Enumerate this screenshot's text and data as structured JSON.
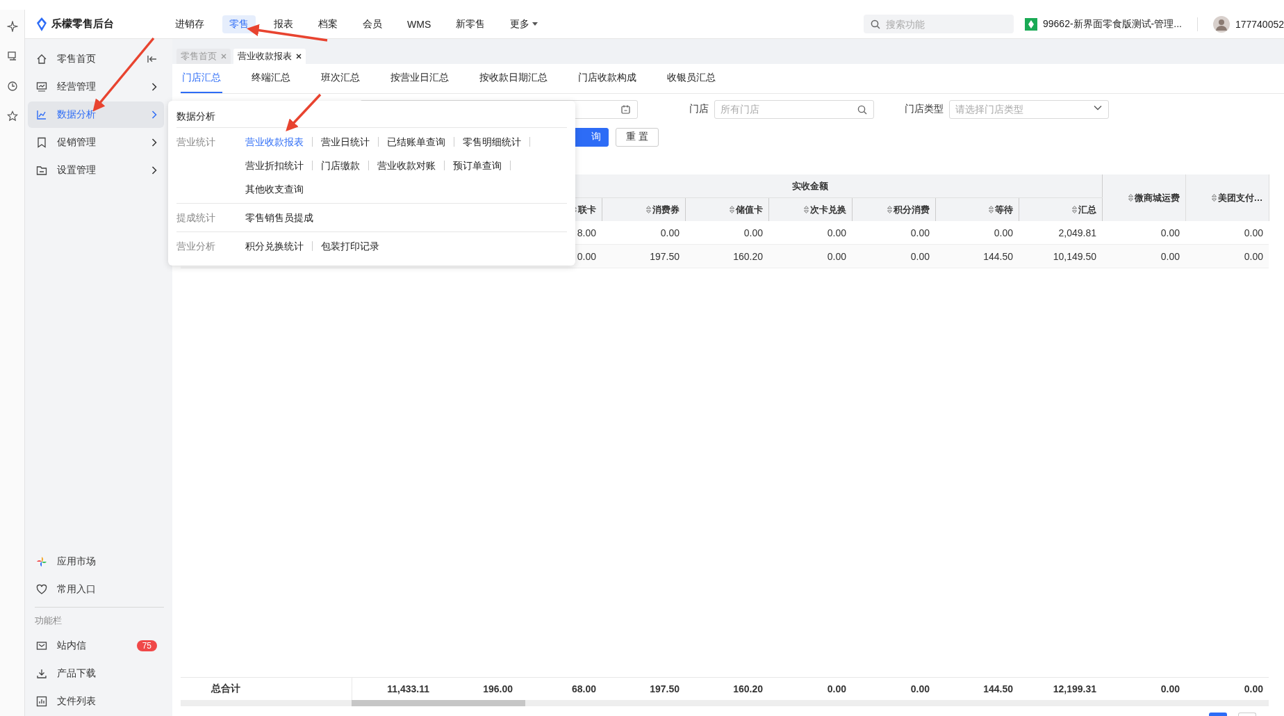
{
  "header": {
    "logo": "乐檬零售后台",
    "nav": [
      {
        "label": "进销存",
        "selected": false,
        "kind": "link"
      },
      {
        "label": "零售",
        "selected": true,
        "kind": "link"
      },
      {
        "label": "报表",
        "selected": false,
        "kind": "link"
      },
      {
        "label": "档案",
        "selected": false,
        "kind": "link"
      },
      {
        "label": "会员",
        "selected": false,
        "kind": "link"
      },
      {
        "label": "WMS",
        "selected": false,
        "kind": "link"
      },
      {
        "label": "新零售",
        "selected": false,
        "kind": "link"
      },
      {
        "label": "更多",
        "selected": false,
        "kind": "dropdown"
      }
    ],
    "search": {
      "placeholder": "搜索功能"
    },
    "store": "99662-新界面零食版测试-管理...",
    "user": "177740052"
  },
  "sidebar": {
    "items": [
      {
        "label": "零售首页",
        "selected": false,
        "kind": "home"
      },
      {
        "label": "经营管理",
        "selected": false,
        "kind": "group"
      },
      {
        "label": "数据分析",
        "selected": true,
        "kind": "group"
      },
      {
        "label": "促销管理",
        "selected": false,
        "kind": "group"
      },
      {
        "label": "设置管理",
        "selected": false,
        "kind": "group"
      }
    ],
    "shortcuts": [
      "应用市场",
      "常用入口"
    ],
    "section_label": "功能栏",
    "tools": [
      {
        "label": "站内信",
        "badge": "75"
      },
      {
        "label": "产品下载"
      },
      {
        "label": "文件列表"
      }
    ]
  },
  "page_tabs": [
    {
      "label": "零售首页",
      "selected": false
    },
    {
      "label": "营业收款报表",
      "selected": true
    }
  ],
  "report_tabs": [
    {
      "label": "门店汇总",
      "selected": true
    },
    {
      "label": "终端汇总",
      "selected": false
    },
    {
      "label": "班次汇总",
      "selected": false
    },
    {
      "label": "按营业日汇总",
      "selected": false
    },
    {
      "label": "按收款日期汇总",
      "selected": false
    },
    {
      "label": "门店收款构成",
      "selected": false
    },
    {
      "label": "收银员汇总",
      "selected": false
    }
  ],
  "filters": {
    "store": {
      "label": "门店",
      "placeholder": "所有门店"
    },
    "store_type": {
      "label": "门店类型",
      "placeholder": "请选择门店类型"
    }
  },
  "buttons": [
    {
      "label": "询",
      "kind": "primary"
    },
    {
      "label": "重置",
      "kind": "default"
    }
  ],
  "menu": {
    "title": "数据分析",
    "groups": [
      {
        "label": "营业统计",
        "items": [
          {
            "label": "营业收款报表",
            "selected": true
          },
          {
            "label": "营业日统计",
            "selected": false
          },
          {
            "label": "已结账单查询",
            "selected": false
          },
          {
            "label": "零售明细统计",
            "selected": false
          },
          {
            "label": "营业折扣统计",
            "selected": false
          },
          {
            "label": "门店缴款",
            "selected": false
          },
          {
            "label": "营业收款对账",
            "selected": false
          },
          {
            "label": "预订单查询",
            "selected": false
          },
          {
            "label": "其他收支查询",
            "selected": false
          }
        ]
      },
      {
        "label": "提成统计",
        "items": [
          {
            "label": "零售销售员提成",
            "selected": false
          }
        ]
      },
      {
        "label": "营业分析",
        "items": [
          {
            "label": "积分兑换统计",
            "selected": false
          },
          {
            "label": "包装打印记录",
            "selected": false
          }
        ]
      }
    ]
  },
  "table": {
    "group_header": "实收金额",
    "columns": [
      "联卡",
      "消费券",
      "储值卡",
      "次卡兑换",
      "积分消费",
      "等待",
      "汇总",
      "微商城运费",
      "美团支付…"
    ],
    "rows": [
      {
        "cells": [
          "8.00",
          "0.00",
          "0.00",
          "0.00",
          "0.00",
          "0.00",
          "2,049.81",
          "0.00",
          "0.00"
        ]
      },
      {
        "cells": [
          "0.00",
          "197.50",
          "160.20",
          "0.00",
          "0.00",
          "144.50",
          "10,149.50",
          "0.00",
          "0.00"
        ]
      }
    ],
    "total": {
      "label": "总合计",
      "cells": [
        "11,433.11",
        "196.00",
        "68.00",
        "197.50",
        "160.20",
        "0.00",
        "0.00",
        "144.50",
        "12,199.31",
        "0.00",
        "0.00"
      ]
    }
  }
}
